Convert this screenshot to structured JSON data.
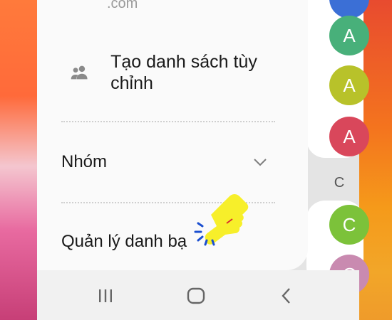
{
  "drawer": {
    "email_fragment": ".com",
    "custom_list_label": "Tạo danh sách tùy chỉnh",
    "groups_label": "Nhóm",
    "manage_contacts_label": "Quản lý danh bạ"
  },
  "contacts": {
    "section_letter": "C",
    "avatars": [
      {
        "letter": "",
        "color": "#3b6fd6"
      },
      {
        "letter": "A",
        "color": "#48b07a"
      },
      {
        "letter": "A",
        "color": "#b8c22a"
      },
      {
        "letter": "A",
        "color": "#d9475b"
      },
      {
        "letter": "C",
        "color": "#7cc23a"
      },
      {
        "letter": "C",
        "color": "#c98ab0"
      }
    ]
  },
  "icons": {
    "custom_list": "people-icon",
    "groups": "chevron-down-icon",
    "pointer": "pointing-hand-icon",
    "nav": [
      "recent-apps-icon",
      "home-icon",
      "back-icon"
    ]
  },
  "colors": {
    "drawer_bg": "#fafafa",
    "navbar_bg": "#f1f1f1",
    "hand": "#f7ef2a"
  }
}
